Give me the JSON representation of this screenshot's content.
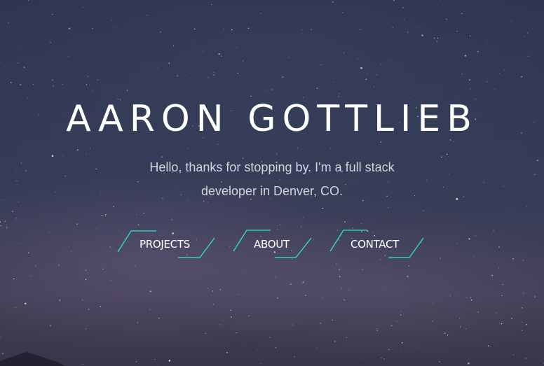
{
  "hero": {
    "name": "AARON GOTTLIEB",
    "intro_line_1": "Hello, thanks for stopping by. I'm a full stack",
    "intro_line_2": "developer in Denver, CO."
  },
  "nav": {
    "items": [
      {
        "label": "PROJECTS"
      },
      {
        "label": "ABOUT"
      },
      {
        "label": "CONTACT"
      }
    ]
  },
  "colors": {
    "accent": "#2ee6c4",
    "text": "#ffffff",
    "subtext": "#d3d4dc",
    "sky": "#323a55"
  }
}
